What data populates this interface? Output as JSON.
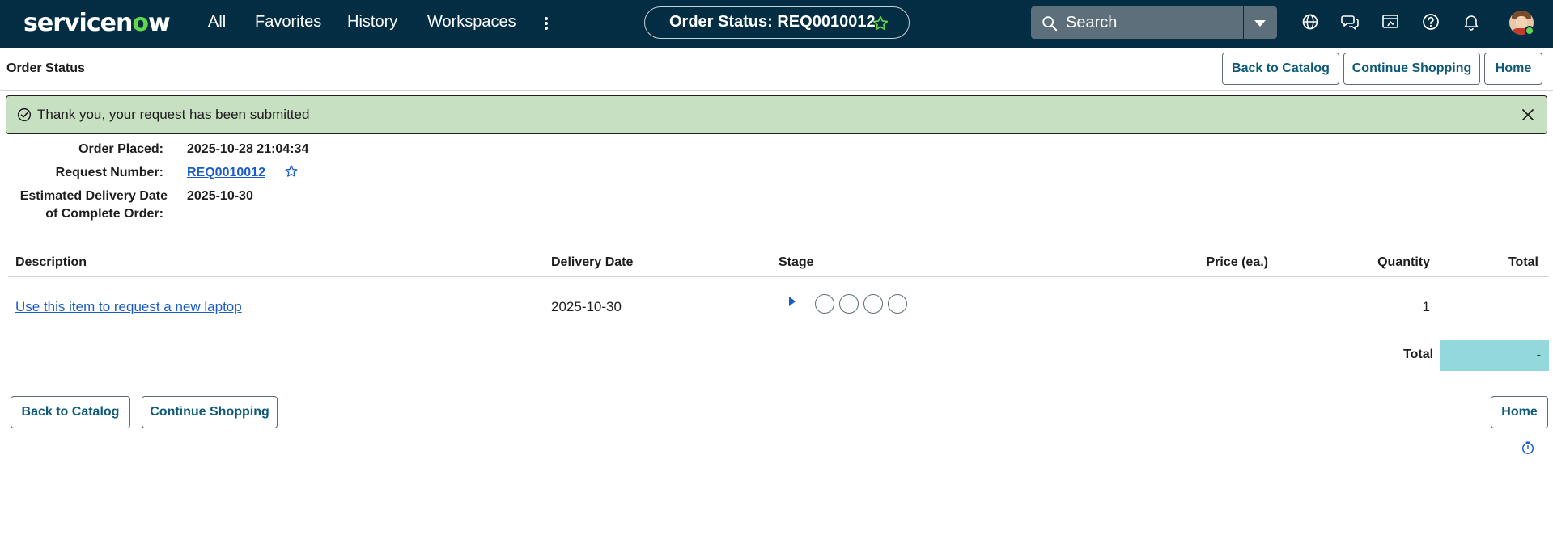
{
  "topnav": {
    "logo": "servicenow",
    "links": [
      "All",
      "Favorites",
      "History",
      "Workspaces"
    ],
    "more_icon": "kebab-icon",
    "context_title": "Order Status: REQ0010012",
    "context_star_icon": "star-outline-icon",
    "search_placeholder": "Search",
    "tool_icons": [
      "globe-icon",
      "chat-icon",
      "admin-icon",
      "help-icon",
      "bell-icon"
    ],
    "accent_color": "#62d84e",
    "bar_color": "#032d42"
  },
  "page": {
    "title": "Order Status",
    "buttons": {
      "back": "Back to Catalog",
      "continue": "Continue Shopping",
      "home": "Home"
    }
  },
  "alert": {
    "message": "Thank you, your request has been submitted",
    "color": "#c8e0c2"
  },
  "order": {
    "placed_label": "Order Placed:",
    "placed_value": "2025-10-28 21:04:34",
    "request_label": "Request Number:",
    "request_value": "REQ0010012",
    "delivery_label_1": "Estimated Delivery Date",
    "delivery_label_2": "of Complete Order:",
    "delivery_value": "2025-10-30"
  },
  "table": {
    "headers": {
      "description": "Description",
      "delivery_date": "Delivery Date",
      "stage": "Stage",
      "price": "Price (ea.)",
      "quantity": "Quantity",
      "total": "Total"
    },
    "rows": [
      {
        "description": "Use this item to request a new laptop",
        "delivery_date": "2025-10-30",
        "stage_steps": 4,
        "quantity": "1"
      }
    ],
    "total_label": "Total",
    "total_value": "-",
    "total_color": "#93d9dc"
  }
}
